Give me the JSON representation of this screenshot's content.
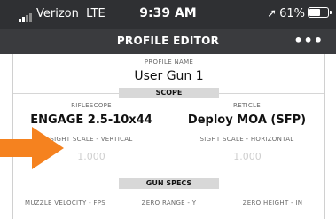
{
  "status_bar": {
    "carrier": "Verizon",
    "network": "LTE",
    "time": "9:39 AM",
    "battery_percent": "61%",
    "battery_level": 0.61
  },
  "nav": {
    "title": "PROFILE EDITOR",
    "more": "•••"
  },
  "profile": {
    "name_label": "PROFILE NAME",
    "name_value": "User Gun 1"
  },
  "scope": {
    "section_label": "SCOPE",
    "riflescope_label": "RIFLESCOPE",
    "riflescope_value": "ENGAGE 2.5-10x44",
    "reticle_label": "RETICLE",
    "reticle_value": "Deploy MOA (SFP)",
    "sight_scale_vertical_label": "SIGHT SCALE - VERTICAL",
    "sight_scale_vertical_value": "1.000",
    "sight_scale_horizontal_label": "SIGHT SCALE - HORIZONTAL",
    "sight_scale_horizontal_value": "1.000"
  },
  "gun_specs": {
    "section_label": "GUN SPECS",
    "muzzle_velocity_label": "MUZZLE VELOCITY - FPS",
    "zero_range_label": "ZERO RANGE - Y",
    "zero_height_label": "ZERO HEIGHT - IN"
  },
  "colors": {
    "arrow": "#f5821f",
    "status_bar_bg": "#2f3033",
    "nav_bg": "#3a3b3e"
  }
}
